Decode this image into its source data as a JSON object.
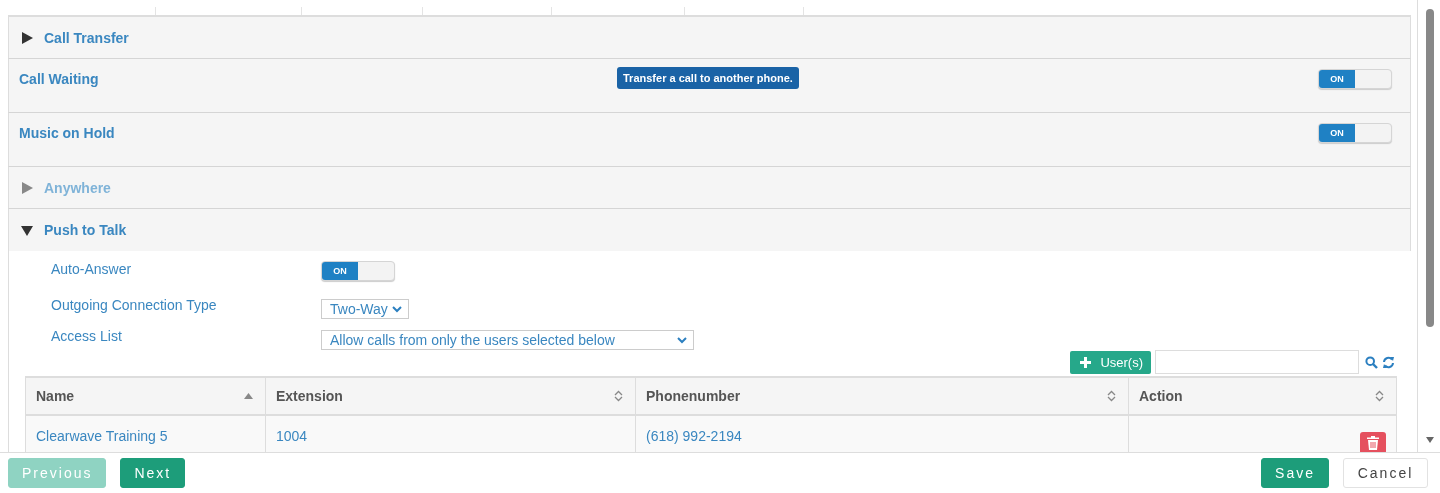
{
  "sections": [
    {
      "kind": "collapsible",
      "title": "Call Transfer",
      "expanded": false,
      "disabled": false
    },
    {
      "kind": "toggle",
      "title": "Call Waiting",
      "on": true,
      "switch_label": "ON",
      "tooltip": "Transfer a call to another phone."
    },
    {
      "kind": "toggle",
      "title": "Music on Hold",
      "on": true,
      "switch_label": "ON"
    },
    {
      "kind": "collapsible",
      "title": "Anywhere",
      "expanded": false,
      "disabled": true
    },
    {
      "kind": "collapsible",
      "title": "Push to Talk",
      "expanded": true,
      "disabled": false
    }
  ],
  "push_to_talk": {
    "settings": [
      {
        "kind": "toggle",
        "label": "Auto-Answer",
        "on": true,
        "switch_label": "ON"
      },
      {
        "kind": "select",
        "label": "Outgoing Connection Type",
        "value": "Two-Way"
      },
      {
        "kind": "select",
        "label": "Access List",
        "value": "Allow calls from only the users selected below"
      }
    ],
    "add_button": "User(s)",
    "table": {
      "columns": [
        {
          "label": "Name",
          "sorted": true
        },
        {
          "label": "Extension",
          "sorted": false
        },
        {
          "label": "Phonenumber",
          "sorted": false
        },
        {
          "label": "Action",
          "sorted": false
        }
      ],
      "rows": [
        {
          "name": "Clearwave Training 5",
          "extension": "1004",
          "phonenumber": "(618) 992-2194"
        }
      ]
    }
  },
  "footer": {
    "buttons": [
      {
        "label": "Previous",
        "kind": "primary",
        "disabled": true
      },
      {
        "label": "Next",
        "kind": "primary",
        "disabled": false
      },
      {
        "label": "Save",
        "kind": "primary",
        "disabled": false
      },
      {
        "label": "Cancel",
        "kind": "plain",
        "disabled": false
      }
    ]
  }
}
